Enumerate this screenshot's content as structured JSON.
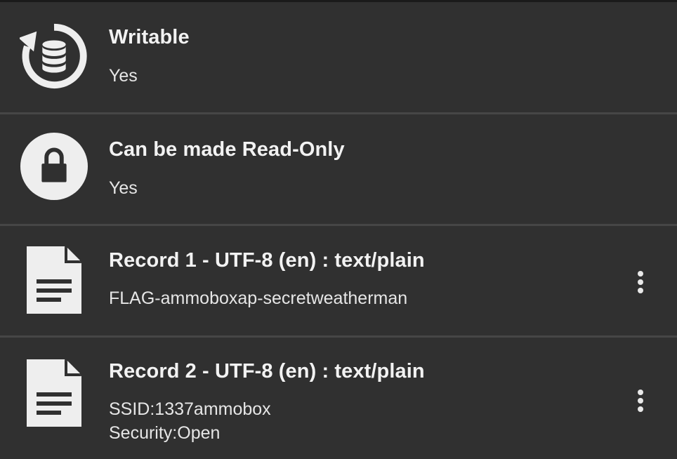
{
  "rows": [
    {
      "title": "Writable",
      "value": "Yes",
      "icon": "database-sync-icon"
    },
    {
      "title": "Can be made Read-Only",
      "value": "Yes",
      "icon": "lock-icon"
    },
    {
      "title": "Record 1 - UTF-8 (en) : text/plain",
      "value": "FLAG-ammoboxap-secretweatherman",
      "icon": "document-icon",
      "menu": "more-options-icon"
    },
    {
      "title": "Record 2 - UTF-8 (en) : text/plain",
      "value_lines": [
        "SSID:1337ammobox",
        "Security:Open"
      ],
      "icon": "document-icon",
      "menu": "more-options-icon"
    }
  ],
  "colors": {
    "background": "#303030",
    "divider": "#464646",
    "icon": "#eeeeee",
    "text": "#f2f2f2"
  }
}
